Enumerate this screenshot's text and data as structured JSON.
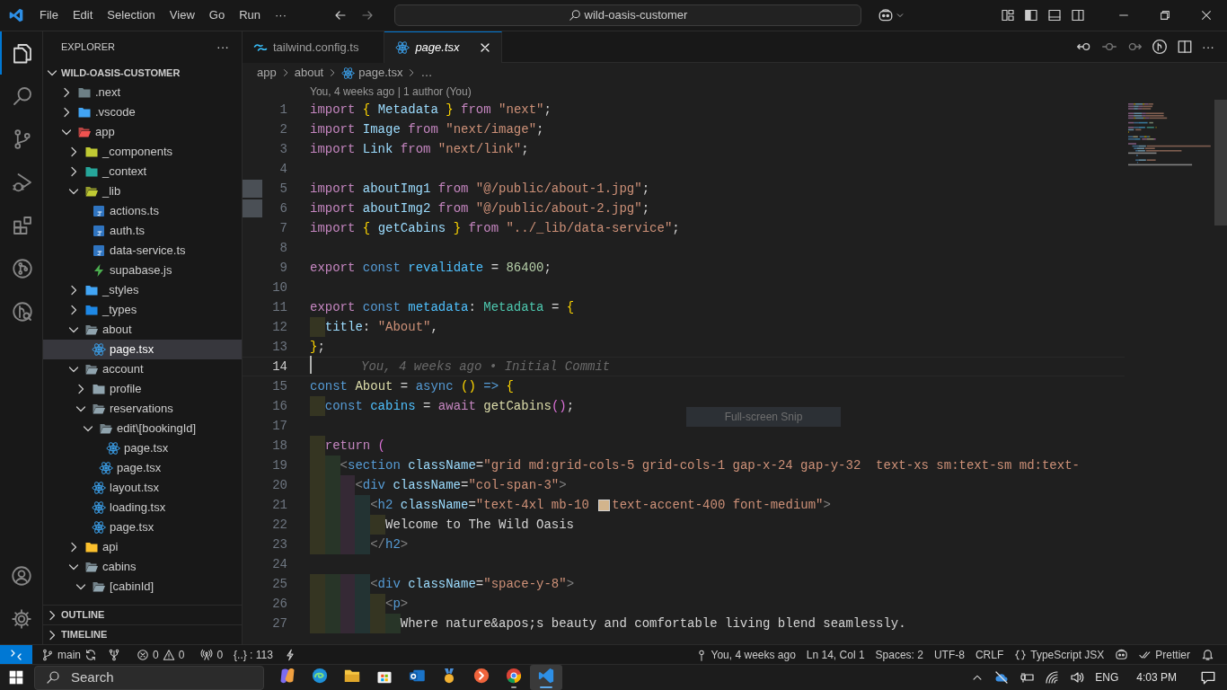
{
  "title_bar": {
    "menu": [
      "File",
      "Edit",
      "Selection",
      "View",
      "Go",
      "Run",
      "···"
    ],
    "command_center": "wild-oasis-customer"
  },
  "activity_bar": [
    {
      "kind": "files",
      "selected": true
    },
    {
      "kind": "search",
      "selected": false
    },
    {
      "kind": "source-control",
      "selected": false
    },
    {
      "kind": "run-debug",
      "selected": false
    },
    {
      "kind": "extensions",
      "selected": false
    },
    {
      "kind": "git-graph",
      "selected": false
    },
    {
      "kind": "git-inspect",
      "selected": false
    }
  ],
  "explorer": {
    "title": "EXPLORER",
    "more": "···",
    "root": {
      "label": "WILD-OASIS-CUSTOMER",
      "expanded": true
    },
    "tree": [
      {
        "label": ".next",
        "kind": "folder",
        "color": "#6d8086",
        "expanded": false,
        "selected": false
      },
      {
        "label": ".vscode",
        "kind": "folder",
        "color": "#42a5f5",
        "expanded": false,
        "selected": false
      },
      {
        "label": "app",
        "kind": "folder",
        "color": "#ef5350",
        "expanded": true,
        "selected": false,
        "children": [
          {
            "label": "_components",
            "kind": "folder",
            "color": "#c0ca33",
            "expanded": false,
            "selected": false
          },
          {
            "label": "_context",
            "kind": "folder",
            "color": "#26a69a",
            "expanded": false,
            "selected": false
          },
          {
            "label": "_lib",
            "kind": "folder",
            "color": "#c0ca33",
            "expanded": true,
            "selected": false,
            "children": [
              {
                "label": "actions.ts",
                "kind": "ts",
                "selected": false
              },
              {
                "label": "auth.ts",
                "kind": "ts",
                "selected": false
              },
              {
                "label": "data-service.ts",
                "kind": "ts",
                "selected": false
              },
              {
                "label": "supabase.js",
                "kind": "bolt",
                "selected": false
              }
            ]
          },
          {
            "label": "_styles",
            "kind": "folder",
            "color": "#42a5f5",
            "expanded": false,
            "selected": false
          },
          {
            "label": "_types",
            "kind": "folder",
            "color": "#1e88e5",
            "expanded": false,
            "selected": false
          },
          {
            "label": "about",
            "kind": "folder",
            "color": "#90a4ae",
            "expanded": true,
            "selected": false,
            "children": [
              {
                "label": "page.tsx",
                "kind": "react",
                "selected": true
              }
            ]
          },
          {
            "label": "account",
            "kind": "folder",
            "color": "#90a4ae",
            "expanded": true,
            "selected": false,
            "children": [
              {
                "label": "profile",
                "kind": "folder",
                "color": "#90a4ae",
                "expanded": false,
                "selected": false
              },
              {
                "label": "reservations",
                "kind": "folder",
                "color": "#90a4ae",
                "expanded": true,
                "selected": false,
                "children": [
                  {
                    "label": "edit\\[bookingId]",
                    "kind": "folder",
                    "color": "#90a4ae",
                    "expanded": true,
                    "selected": false,
                    "children": [
                      {
                        "label": "page.tsx",
                        "kind": "react",
                        "selected": false
                      }
                    ]
                  },
                  {
                    "label": "page.tsx",
                    "kind": "react",
                    "selected": false
                  }
                ]
              },
              {
                "label": "layout.tsx",
                "kind": "react",
                "selected": false
              },
              {
                "label": "loading.tsx",
                "kind": "react",
                "selected": false
              },
              {
                "label": "page.tsx",
                "kind": "react",
                "selected": false
              }
            ]
          },
          {
            "label": "api",
            "kind": "folder",
            "color": "#fbc02d",
            "expanded": false,
            "selected": false
          },
          {
            "label": "cabins",
            "kind": "folder",
            "color": "#90a4ae",
            "expanded": true,
            "selected": false,
            "children": [
              {
                "label": "[cabinId]",
                "kind": "folder",
                "color": "#90a4ae",
                "expanded": true,
                "selected": false
              }
            ]
          }
        ]
      }
    ],
    "sections": [
      {
        "label": "OUTLINE",
        "expanded": false
      },
      {
        "label": "TIMELINE",
        "expanded": false
      }
    ]
  },
  "tabs": [
    {
      "label": "tailwind.config.ts",
      "kind": "wave",
      "selected": false,
      "preview": false
    },
    {
      "label": "page.tsx",
      "kind": "react",
      "selected": true,
      "preview": true
    }
  ],
  "breadcrumb": [
    {
      "label": "app",
      "kind": "folder"
    },
    {
      "label": "about",
      "kind": "folder"
    },
    {
      "label": "page.tsx",
      "kind": "react"
    },
    {
      "label": "…",
      "kind": "more"
    }
  ],
  "codelens": "You, 4 weeks ago | 1 author (You)",
  "code": [
    {
      "number": "1",
      "current": false,
      "thumbnail": false,
      "tokens": [
        {
          "kind": "kw",
          "text": "import "
        },
        {
          "kind": "b1",
          "text": "{ "
        },
        {
          "kind": "var",
          "text": "Metadata "
        },
        {
          "kind": "b1",
          "text": "} "
        },
        {
          "kind": "kw",
          "text": "from "
        },
        {
          "kind": "str",
          "text": "\"next\""
        },
        {
          "kind": "p",
          "text": ";"
        }
      ]
    },
    {
      "number": "2",
      "current": false,
      "thumbnail": false,
      "tokens": [
        {
          "kind": "kw",
          "text": "import "
        },
        {
          "kind": "var",
          "text": "Image "
        },
        {
          "kind": "kw",
          "text": "from "
        },
        {
          "kind": "str",
          "text": "\"next/image\""
        },
        {
          "kind": "p",
          "text": ";"
        }
      ]
    },
    {
      "number": "3",
      "current": false,
      "thumbnail": false,
      "tokens": [
        {
          "kind": "kw",
          "text": "import "
        },
        {
          "kind": "var",
          "text": "Link "
        },
        {
          "kind": "kw",
          "text": "from "
        },
        {
          "kind": "str",
          "text": "\"next/link\""
        },
        {
          "kind": "p",
          "text": ";"
        }
      ]
    },
    {
      "number": "4",
      "current": false,
      "thumbnail": false
    },
    {
      "number": "5",
      "current": false,
      "thumbnail": true,
      "tokens": [
        {
          "kind": "kw",
          "text": "import "
        },
        {
          "kind": "var",
          "text": "aboutImg1 "
        },
        {
          "kind": "kw",
          "text": "from "
        },
        {
          "kind": "str",
          "text": "\"@/public/about-1.jpg\""
        },
        {
          "kind": "p",
          "text": ";"
        }
      ]
    },
    {
      "number": "6",
      "current": false,
      "thumbnail": true,
      "tokens": [
        {
          "kind": "kw",
          "text": "import "
        },
        {
          "kind": "var",
          "text": "aboutImg2 "
        },
        {
          "kind": "kw",
          "text": "from "
        },
        {
          "kind": "str",
          "text": "\"@/public/about-2.jpg\""
        },
        {
          "kind": "p",
          "text": ";"
        }
      ]
    },
    {
      "number": "7",
      "current": false,
      "thumbnail": false,
      "tokens": [
        {
          "kind": "kw",
          "text": "import "
        },
        {
          "kind": "b1",
          "text": "{ "
        },
        {
          "kind": "var",
          "text": "getCabins "
        },
        {
          "kind": "b1",
          "text": "} "
        },
        {
          "kind": "kw",
          "text": "from "
        },
        {
          "kind": "str",
          "text": "\"../_lib/data-service\""
        },
        {
          "kind": "p",
          "text": ";"
        }
      ]
    },
    {
      "number": "8",
      "current": false,
      "thumbnail": false
    },
    {
      "number": "9",
      "current": false,
      "thumbnail": false,
      "tokens": [
        {
          "kind": "kw",
          "text": "export "
        },
        {
          "kind": "st",
          "text": "const "
        },
        {
          "kind": "cnst",
          "text": "revalidate "
        },
        {
          "kind": "p",
          "text": "= "
        },
        {
          "kind": "num",
          "text": "86400"
        },
        {
          "kind": "p",
          "text": ";"
        }
      ]
    },
    {
      "number": "10",
      "current": false,
      "thumbnail": false
    },
    {
      "number": "11",
      "current": false,
      "thumbnail": false,
      "tokens": [
        {
          "kind": "kw",
          "text": "export "
        },
        {
          "kind": "st",
          "text": "const "
        },
        {
          "kind": "cnst",
          "text": "metadata"
        },
        {
          "kind": "p",
          "text": ": "
        },
        {
          "kind": "type",
          "text": "Metadata "
        },
        {
          "kind": "p",
          "text": "= "
        },
        {
          "kind": "b1",
          "text": "{"
        }
      ]
    },
    {
      "number": "12",
      "current": false,
      "thumbnail": false,
      "tokens": [
        {
          "kind": "var",
          "text": "  title"
        },
        {
          "kind": "p",
          "text": ": "
        },
        {
          "kind": "str",
          "text": "\"About\""
        },
        {
          "kind": "p",
          "text": ","
        }
      ]
    },
    {
      "number": "13",
      "current": false,
      "thumbnail": false,
      "tokens": [
        {
          "kind": "b1",
          "text": "}"
        },
        {
          "kind": "p",
          "text": ";"
        }
      ]
    },
    {
      "number": "14",
      "current": true,
      "thumbnail": false,
      "blame": "You, 4 weeks ago • Initial Commit"
    },
    {
      "number": "15",
      "current": false,
      "thumbnail": false,
      "tokens": [
        {
          "kind": "st",
          "text": "const "
        },
        {
          "kind": "fn",
          "text": "About "
        },
        {
          "kind": "p",
          "text": "= "
        },
        {
          "kind": "st",
          "text": "async "
        },
        {
          "kind": "b1",
          "text": "() "
        },
        {
          "kind": "st",
          "text": "=> "
        },
        {
          "kind": "b1",
          "text": "{"
        }
      ]
    },
    {
      "number": "16",
      "current": false,
      "thumbnail": false,
      "tokens": [
        {
          "kind": "st",
          "text": "  const "
        },
        {
          "kind": "cnst",
          "text": "cabins "
        },
        {
          "kind": "p",
          "text": "= "
        },
        {
          "kind": "kw",
          "text": "await "
        },
        {
          "kind": "fn",
          "text": "getCabins"
        },
        {
          "kind": "b2",
          "text": "()"
        },
        {
          "kind": "p",
          "text": ";"
        }
      ]
    },
    {
      "number": "17",
      "current": false,
      "thumbnail": false
    },
    {
      "number": "18",
      "current": false,
      "thumbnail": false,
      "tokens": [
        {
          "kind": "kw",
          "text": "  return "
        },
        {
          "kind": "b2",
          "text": "("
        }
      ]
    },
    {
      "number": "19",
      "current": false,
      "thumbnail": false,
      "tokens": [
        {
          "kind": "tagp",
          "text": "    <"
        },
        {
          "kind": "tag",
          "text": "section "
        },
        {
          "kind": "attr",
          "text": "className"
        },
        {
          "kind": "p",
          "text": "="
        },
        {
          "kind": "str",
          "text": "\"grid md:grid-cols-5 grid-cols-1 gap-x-24 gap-y-32  text-xs sm:text-sm md:text-"
        }
      ]
    },
    {
      "number": "20",
      "current": false,
      "thumbnail": false,
      "tokens": [
        {
          "kind": "tagp",
          "text": "      <"
        },
        {
          "kind": "tag",
          "text": "div "
        },
        {
          "kind": "attr",
          "text": "className"
        },
        {
          "kind": "p",
          "text": "="
        },
        {
          "kind": "str",
          "text": "\"col-span-3\""
        },
        {
          "kind": "tagp",
          "text": ">"
        }
      ]
    },
    {
      "number": "21",
      "current": false,
      "thumbnail": false,
      "tokens": [
        {
          "kind": "tagp",
          "text": "        <"
        },
        {
          "kind": "tag",
          "text": "h2 "
        },
        {
          "kind": "attr",
          "text": "className"
        },
        {
          "kind": "p",
          "text": "="
        },
        {
          "kind": "str",
          "text": "\"text-4xl mb-10 "
        },
        {
          "kind": "swatch",
          "color": "#d2b48c"
        },
        {
          "kind": "str",
          "text": "text-accent-400 font-medium\""
        },
        {
          "kind": "tagp",
          "text": ">"
        }
      ]
    },
    {
      "number": "22",
      "current": false,
      "thumbnail": false,
      "tokens": [
        {
          "kind": "txt",
          "text": "          Welcome to The Wild Oasis"
        }
      ]
    },
    {
      "number": "23",
      "current": false,
      "thumbnail": false,
      "tokens": [
        {
          "kind": "tagp",
          "text": "        </"
        },
        {
          "kind": "tag",
          "text": "h2"
        },
        {
          "kind": "tagp",
          "text": ">"
        }
      ]
    },
    {
      "number": "24",
      "current": false,
      "thumbnail": false
    },
    {
      "number": "25",
      "current": false,
      "thumbnail": false,
      "tokens": [
        {
          "kind": "tagp",
          "text": "        <"
        },
        {
          "kind": "tag",
          "text": "div "
        },
        {
          "kind": "attr",
          "text": "className"
        },
        {
          "kind": "p",
          "text": "="
        },
        {
          "kind": "str",
          "text": "\"space-y-8\""
        },
        {
          "kind": "tagp",
          "text": ">"
        }
      ]
    },
    {
      "number": "26",
      "current": false,
      "thumbnail": false,
      "tokens": [
        {
          "kind": "tagp",
          "text": "          <"
        },
        {
          "kind": "tag",
          "text": "p"
        },
        {
          "kind": "tagp",
          "text": ">"
        }
      ]
    },
    {
      "number": "27",
      "current": false,
      "thumbnail": false,
      "tokens": [
        {
          "kind": "txt",
          "text": "            Where nature&apos;s beauty and comfortable living blend seamlessly."
        }
      ]
    }
  ],
  "snip_tooltip": "Full-screen Snip",
  "status_bar": {
    "left": [
      {
        "kind": "remote"
      },
      {
        "kind": "branch",
        "text": "main"
      },
      {
        "kind": "git-tool"
      },
      {
        "kind": "problems",
        "errors": "0",
        "warnings": "0"
      },
      {
        "kind": "ports",
        "text": "0"
      },
      {
        "kind": "plain",
        "text": "{..} : 113"
      },
      {
        "kind": "bolt"
      }
    ],
    "right": [
      {
        "kind": "blame",
        "text": "You, 4 weeks ago"
      },
      {
        "kind": "plain",
        "text": "Ln 14, Col 1"
      },
      {
        "kind": "plain",
        "text": "Spaces: 2"
      },
      {
        "kind": "plain",
        "text": "UTF-8"
      },
      {
        "kind": "plain",
        "text": "CRLF"
      },
      {
        "kind": "language",
        "text": "TypeScript JSX"
      },
      {
        "kind": "copilot"
      },
      {
        "kind": "prettier",
        "text": "Prettier"
      },
      {
        "kind": "bell"
      }
    ]
  },
  "taskbar": {
    "search": "Search",
    "apps": [
      {
        "kind": "copilot",
        "running": false,
        "selected": false
      },
      {
        "kind": "edge",
        "running": false,
        "selected": false
      },
      {
        "kind": "files",
        "running": false,
        "selected": false
      },
      {
        "kind": "store",
        "running": false,
        "selected": false
      },
      {
        "kind": "mail",
        "running": false,
        "selected": false
      },
      {
        "kind": "medal",
        "running": false,
        "selected": false
      },
      {
        "kind": "record",
        "running": false,
        "selected": false
      },
      {
        "kind": "chrome",
        "running": true,
        "selected": false
      },
      {
        "kind": "vscode",
        "running": true,
        "selected": true
      }
    ],
    "tray": {
      "language": "ENG",
      "time": "4:03 PM"
    }
  }
}
